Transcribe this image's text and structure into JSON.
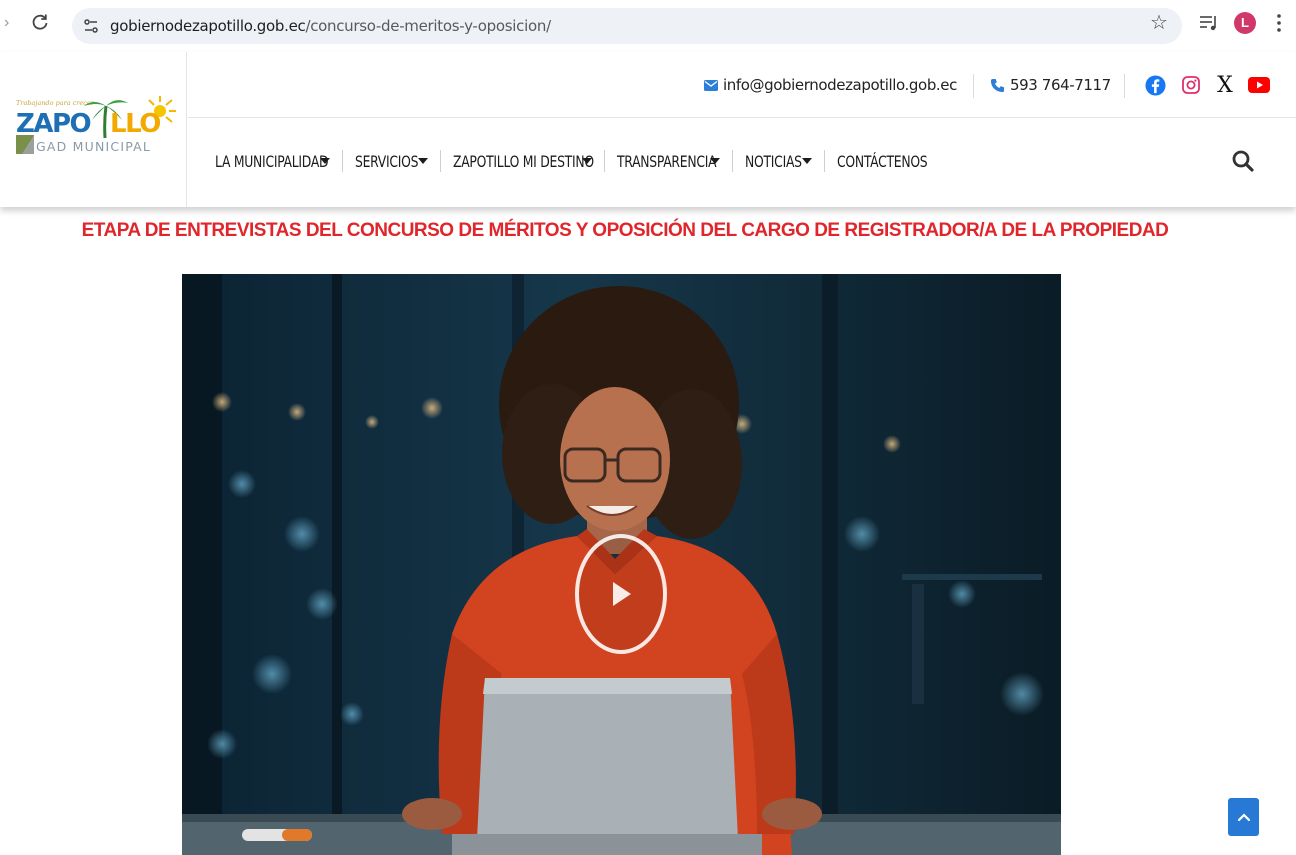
{
  "browser": {
    "url_host": "gobiernodezapotillo.gob.ec",
    "url_path": "/concurso-de-meritos-y-oposicion/",
    "profile_initial": "L"
  },
  "header": {
    "logo": {
      "tagline": "Trabajando para crecer",
      "name": "ZAPOTILLO",
      "subtitle": "GAD MUNICIPAL"
    },
    "contact": {
      "email": "info@gobiernodezapotillo.gob.ec",
      "phone": "593 764-7117"
    },
    "socials": [
      "facebook-icon",
      "instagram-icon",
      "x-icon",
      "youtube-icon"
    ],
    "menu": [
      {
        "label": "LA MUNICIPALIDAD",
        "has_dropdown": true
      },
      {
        "label": "SERVICIOS",
        "has_dropdown": true
      },
      {
        "label": "ZAPOTILLO MI DESTINO",
        "has_dropdown": true
      },
      {
        "label": "TRANSPARENCIA",
        "has_dropdown": true
      },
      {
        "label": "NOTICIAS",
        "has_dropdown": true
      },
      {
        "label": "CONTÁCTENOS",
        "has_dropdown": false
      }
    ]
  },
  "main": {
    "title": "ETAPA DE ENTREVISTAS DEL CONCURSO DE MÉRITOS Y OPOSICIÓN DEL CARGO DE REGISTRADOR/A DE LA PROPIEDAD"
  },
  "colors": {
    "title_red": "#e0262b",
    "accent_blue": "#2879d6",
    "email_icon": "#2b7fd9",
    "phone_icon": "#2b7fd9",
    "facebook": "#1877f2",
    "instagram": "#e1306c",
    "youtube": "#ff0000"
  }
}
